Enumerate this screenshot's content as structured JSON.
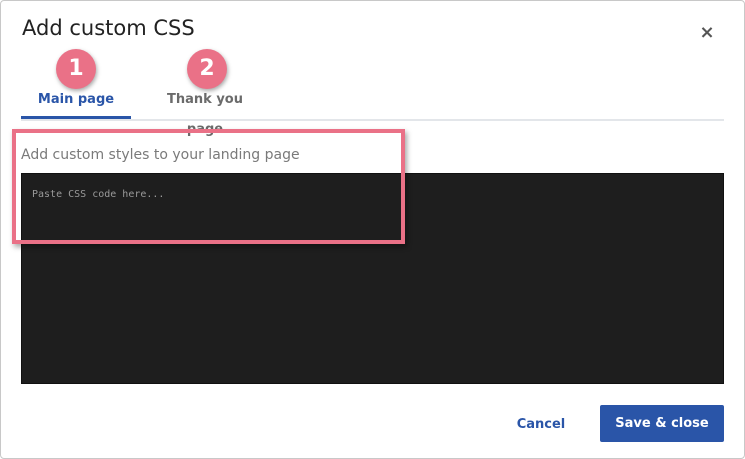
{
  "dialog": {
    "title": "Add custom CSS",
    "close_glyph": "×"
  },
  "tabs": [
    {
      "label": "Main page",
      "active": true,
      "badge": "1"
    },
    {
      "label": "Thank you page",
      "active": false,
      "badge": "2"
    }
  ],
  "editor": {
    "label": "Add custom styles to your landing page",
    "value": "",
    "placeholder": "Paste CSS code here..."
  },
  "footer": {
    "cancel_label": "Cancel",
    "save_label": "Save & close"
  },
  "colors": {
    "accent": "#2a55a8",
    "annotation": "#ea7187",
    "editor_bg": "#1e1e1e"
  },
  "icons": {
    "close": "close-icon"
  }
}
